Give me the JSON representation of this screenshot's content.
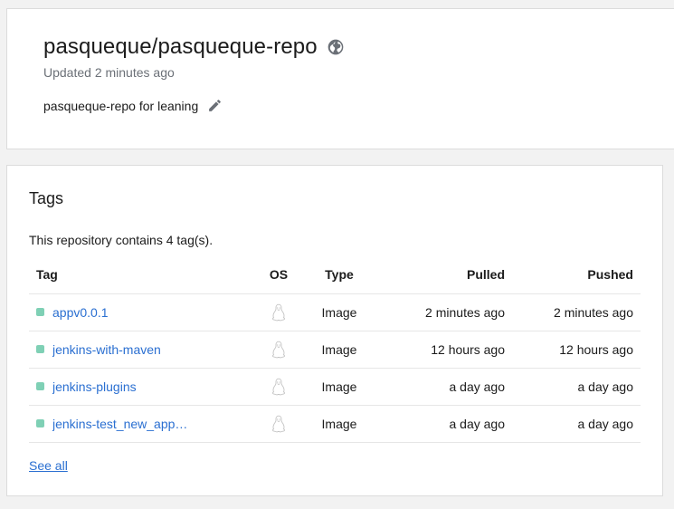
{
  "repo": {
    "title": "pasqueque/pasqueque-repo",
    "updated": "Updated 2 minutes ago",
    "description": "pasqueque-repo for leaning",
    "visibility_icon": "globe-icon",
    "edit_icon": "pencil-icon"
  },
  "tags": {
    "title": "Tags",
    "summary": "This repository contains 4 tag(s).",
    "columns": {
      "tag": "Tag",
      "os": "OS",
      "type": "Type",
      "pulled": "Pulled",
      "pushed": "Pushed"
    },
    "rows": [
      {
        "tag": "appv0.0.1",
        "type": "Image",
        "pulled": "2 minutes ago",
        "pushed": "2 minutes ago"
      },
      {
        "tag": "jenkins-with-maven",
        "type": "Image",
        "pulled": "12 hours ago",
        "pushed": "12 hours ago"
      },
      {
        "tag": "jenkins-plugins",
        "type": "Image",
        "pulled": "a day ago",
        "pushed": "a day ago"
      },
      {
        "tag": "jenkins-test_new_app…",
        "type": "Image",
        "pulled": "a day ago",
        "pushed": "a day ago"
      }
    ],
    "os_icon": "linux-icon",
    "status_color": "#7fd0b5",
    "see_all": "See all"
  }
}
